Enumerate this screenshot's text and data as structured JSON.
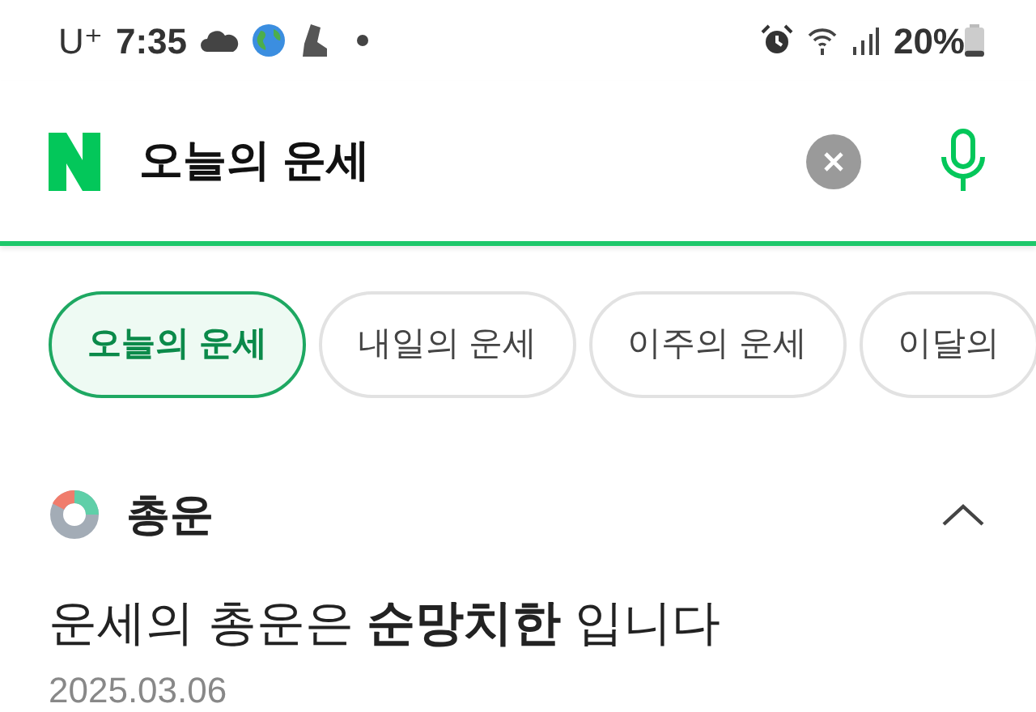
{
  "status_bar": {
    "carrier": "U⁺",
    "time": "7:35",
    "battery": "20%"
  },
  "search": {
    "value": "오늘의 운세"
  },
  "tabs": [
    {
      "label": "오늘의 운세",
      "selected": true
    },
    {
      "label": "내일의 운세",
      "selected": false
    },
    {
      "label": "이주의 운세",
      "selected": false
    },
    {
      "label": "이달의",
      "selected": false
    }
  ],
  "section": {
    "title": "총운",
    "expanded": true,
    "headline": "운세의 총운은 **순망치한** 입니다",
    "date": "2025.03.06"
  }
}
